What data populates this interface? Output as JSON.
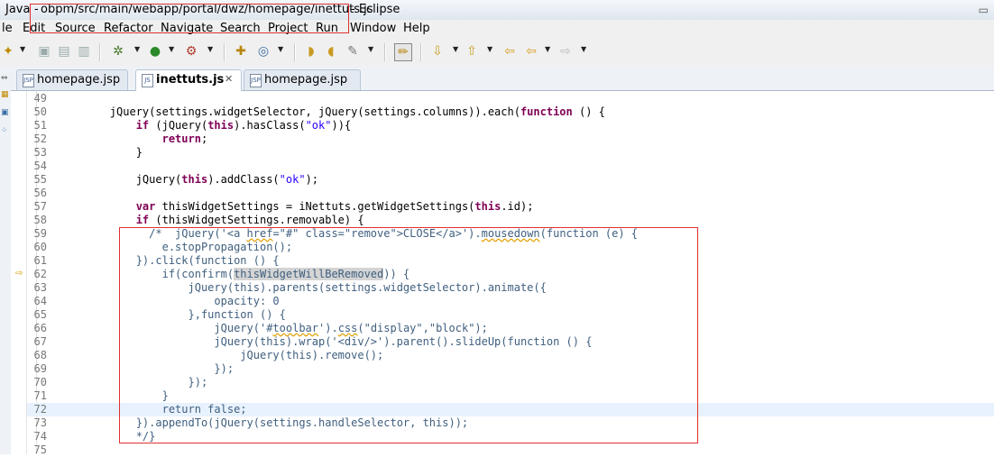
{
  "window": {
    "title_prefix": "Java",
    "title_sep": "-",
    "title_path": "obpm/src/main/webapp/portal/dwz/homepage/inettuts.js",
    "title_app": "- Eclipse"
  },
  "menu": [
    "le",
    "Edit",
    "Source",
    "Refactor",
    "Navigate",
    "Search",
    "Project",
    "Run",
    "Window",
    "Help"
  ],
  "tabs": [
    {
      "label": "homepage.jsp",
      "icon": "jsp-file-icon"
    },
    {
      "label": "inettuts.js",
      "icon": "js-file-icon",
      "close": "✕"
    },
    {
      "label": "homepage.jsp",
      "icon": "jsp-file-icon"
    }
  ],
  "code": [
    {
      "n": "49",
      "t": ""
    },
    {
      "n": "50",
      "t": "        jQuery(settings.widgetSelector, jQuery(settings.columns)).each(<k>function</k> () {"
    },
    {
      "n": "51",
      "t": "            <k>if</k> (jQuery(<k>this</k>).hasClass(<s>\"ok\"</s>)){"
    },
    {
      "n": "52",
      "t": "                <k>return</k>;"
    },
    {
      "n": "53",
      "t": "            }"
    },
    {
      "n": "54",
      "t": ""
    },
    {
      "n": "55",
      "t": "            jQuery(<k>this</k>).addClass(<s>\"ok\"</s>);"
    },
    {
      "n": "56",
      "t": ""
    },
    {
      "n": "57",
      "t": "            <k>var</k> thisWidgetSettings = iNettuts.getWidgetSettings(<k>this</k>.id);"
    },
    {
      "n": "58",
      "t": "            <k>if</k> (thisWidgetSettings.removable) {"
    },
    {
      "n": "59",
      "t": "              <c>/*  jQuery('<a <w>href</w>=\"#\" class=\"remove\">CLOSE</a>').<w>mousedown</w>(function (e) {</c>"
    },
    {
      "n": "60",
      "t": "                <c>e.stopPropagation();</c>"
    },
    {
      "n": "61",
      "t": "            <c>}).click(function () {</c>"
    },
    {
      "n": "62",
      "t": "                <c>if(confirm(</c><h>thisWidgetWillBeRemoved</h><c>)) {</c>"
    },
    {
      "n": "63",
      "t": "                    <c>jQuery(this).parents(settings.widgetSelector).animate({</c>"
    },
    {
      "n": "64",
      "t": "                        <c>opacity: 0</c>"
    },
    {
      "n": "65",
      "t": "                    <c>},function () {</c>"
    },
    {
      "n": "66",
      "t": "                        <c>jQuery('#<w>toolbar</w>').<w>css</w>(\"display\",\"block\");</c>"
    },
    {
      "n": "67",
      "t": "                        <c>jQuery(this).wrap('<div/>').parent().slideUp(function () {</c>"
    },
    {
      "n": "68",
      "t": "                            <c>jQuery(this).remove();</c>"
    },
    {
      "n": "69",
      "t": "                        <c>});</c>"
    },
    {
      "n": "70",
      "t": "                    <c>});</c>"
    },
    {
      "n": "71",
      "t": "                <c>}</c>"
    },
    {
      "n": "72",
      "t": "                <c>return false;</c>"
    },
    {
      "n": "73",
      "t": "            <c>}).appendTo(jQuery(settings.handleSelector, this));</c>"
    },
    {
      "n": "74",
      "t": "            <c>*/}</c>"
    },
    {
      "n": "75",
      "t": ""
    }
  ],
  "current_line": "72"
}
